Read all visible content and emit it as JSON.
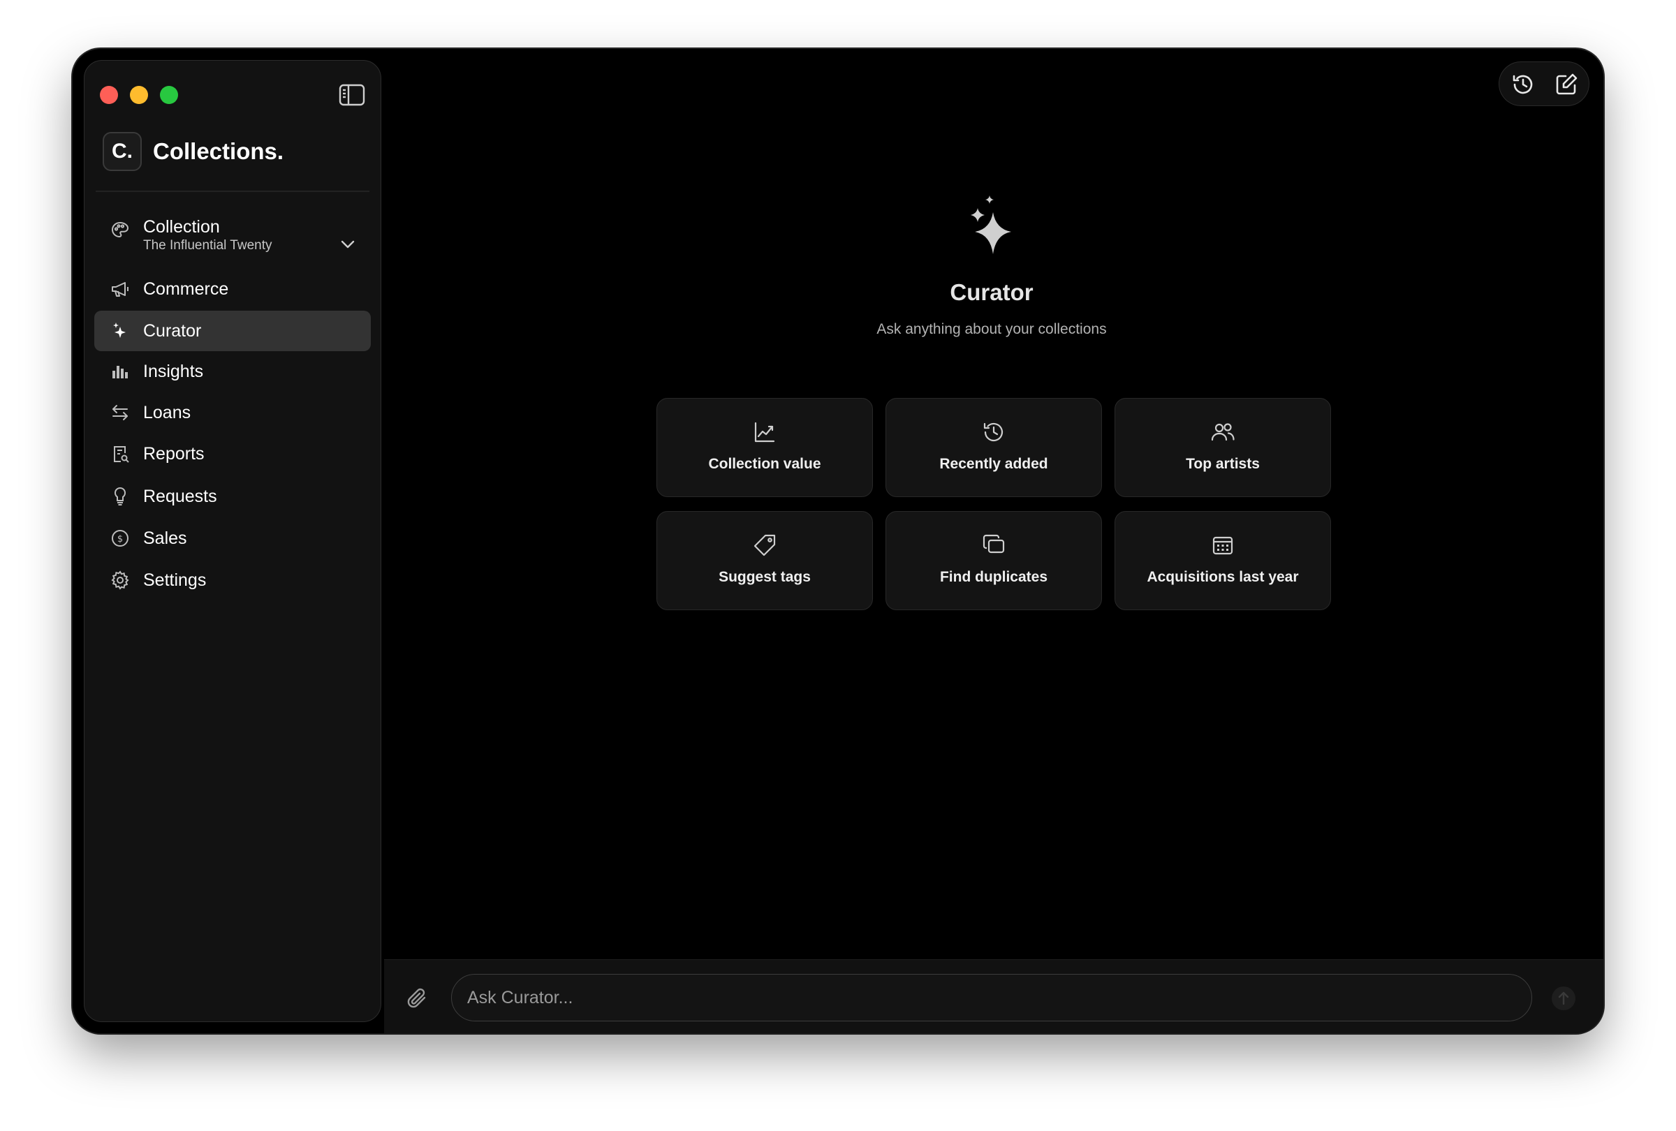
{
  "app": {
    "name": "Collections.",
    "logo_text": "C."
  },
  "sidebar": {
    "items": [
      {
        "id": "collection",
        "label": "Collection",
        "sublabel": "The Influential Twenty",
        "icon": "palette-icon"
      },
      {
        "id": "commerce",
        "label": "Commerce",
        "icon": "megaphone-icon"
      },
      {
        "id": "curator",
        "label": "Curator",
        "icon": "sparkle-icon",
        "active": true
      },
      {
        "id": "insights",
        "label": "Insights",
        "icon": "bar-chart-icon"
      },
      {
        "id": "loans",
        "label": "Loans",
        "icon": "arrows-exchange-icon"
      },
      {
        "id": "reports",
        "label": "Reports",
        "icon": "report-search-icon"
      },
      {
        "id": "requests",
        "label": "Requests",
        "icon": "lightbulb-icon"
      },
      {
        "id": "sales",
        "label": "Sales",
        "icon": "dollar-coin-icon"
      },
      {
        "id": "settings",
        "label": "Settings",
        "icon": "gear-icon"
      }
    ]
  },
  "hero": {
    "title": "Curator",
    "subtitle": "Ask anything about your collections"
  },
  "suggestions": [
    {
      "label": "Collection value",
      "icon": "line-chart-icon"
    },
    {
      "label": "Recently added",
      "icon": "history-icon"
    },
    {
      "label": "Top artists",
      "icon": "users-icon"
    },
    {
      "label": "Suggest tags",
      "icon": "tag-icon"
    },
    {
      "label": "Find duplicates",
      "icon": "duplicate-icon"
    },
    {
      "label": "Acquisitions last year",
      "icon": "calendar-icon"
    }
  ],
  "composer": {
    "placeholder": "Ask Curator...",
    "value": ""
  },
  "colors": {
    "window_bg": "#000000",
    "sidebar_bg": "#121212",
    "active_item": "#333333",
    "card_bg": "#141414"
  }
}
